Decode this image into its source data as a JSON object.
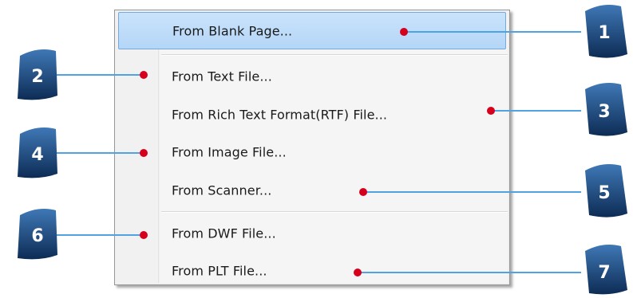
{
  "menu": {
    "items": [
      {
        "label": "From Blank Page...",
        "highlighted": true
      },
      {
        "label": "From Text File..."
      },
      {
        "label": "From Rich Text Format(RTF) File..."
      },
      {
        "label": "From Image File..."
      },
      {
        "label": "From Scanner..."
      },
      {
        "label": "From DWF File..."
      },
      {
        "label": "From PLT File..."
      }
    ]
  },
  "callouts": [
    {
      "number": "1",
      "item": 0
    },
    {
      "number": "2",
      "item": 1
    },
    {
      "number": "3",
      "item": 2
    },
    {
      "number": "4",
      "item": 3
    },
    {
      "number": "5",
      "item": 4
    },
    {
      "number": "6",
      "item": 5
    },
    {
      "number": "7",
      "item": 6
    }
  ],
  "colors": {
    "leader_line": "#4fa3e3",
    "marker_dot": "#d6001c",
    "badge_top": "#3f78b6",
    "badge_bottom": "#0d2c55",
    "highlight": "#c0ddf9"
  }
}
